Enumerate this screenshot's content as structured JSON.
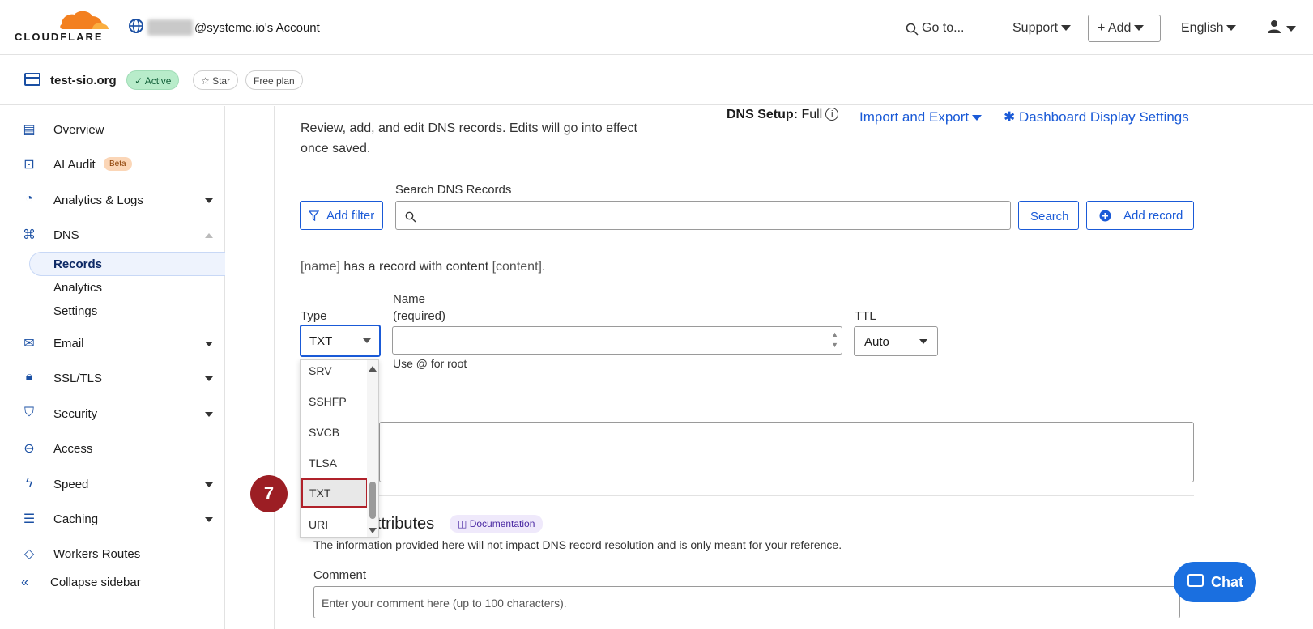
{
  "brand": {
    "name": "CLOUDFLARE",
    "accent": "#f38020"
  },
  "header": {
    "account": "@systeme.io's Account",
    "goto": "Go to...",
    "support": "Support",
    "add": "+ Add",
    "language": "English"
  },
  "zone": {
    "name": "test-sio.org",
    "status": "✓ Active",
    "star": "☆ Star",
    "plan": "Free plan"
  },
  "sidebar": {
    "items": [
      {
        "label": "Overview"
      },
      {
        "label": "AI Audit",
        "badge": "Beta"
      },
      {
        "label": "Analytics & Logs"
      },
      {
        "label": "DNS"
      },
      {
        "label": "Email"
      },
      {
        "label": "SSL/TLS"
      },
      {
        "label": "Security"
      },
      {
        "label": "Access"
      },
      {
        "label": "Speed"
      },
      {
        "label": "Caching"
      },
      {
        "label": "Workers Routes"
      }
    ],
    "dns_sub": [
      "Records",
      "Analytics",
      "Settings"
    ],
    "collapse": "Collapse sidebar"
  },
  "main": {
    "description": "Review, add, and edit DNS records. Edits will go into effect once saved.",
    "dns_setup_label": "DNS Setup:",
    "dns_setup_value": "Full",
    "import_export": "Import and Export",
    "dashboard_settings": "Dashboard Display Settings",
    "search_label": "Search DNS Records",
    "add_filter": "Add filter",
    "search_button": "Search",
    "add_record": "Add record",
    "hint_name": "[name]",
    "hint_mid": " has a record with content ",
    "hint_content": "[content]",
    "hint_end": ".",
    "type_label": "Type",
    "type_value": "TXT",
    "name_label": "Name",
    "name_required": "(required)",
    "name_help": "Use @ for root",
    "ttl_label": "TTL",
    "ttl_value": "Auto",
    "attr_title": "ttributes",
    "documentation": "Documentation",
    "attr_desc": "The information provided here will not impact DNS record resolution and is only meant for your reference.",
    "comment_label": "Comment",
    "comment_placeholder": "Enter your comment here (up to 100 characters)."
  },
  "dropdown": {
    "options": [
      "SRV",
      "SSHFP",
      "SVCB",
      "TLSA",
      "TXT",
      "URI"
    ],
    "highlighted": "TXT"
  },
  "step": "7",
  "chat": "Chat"
}
